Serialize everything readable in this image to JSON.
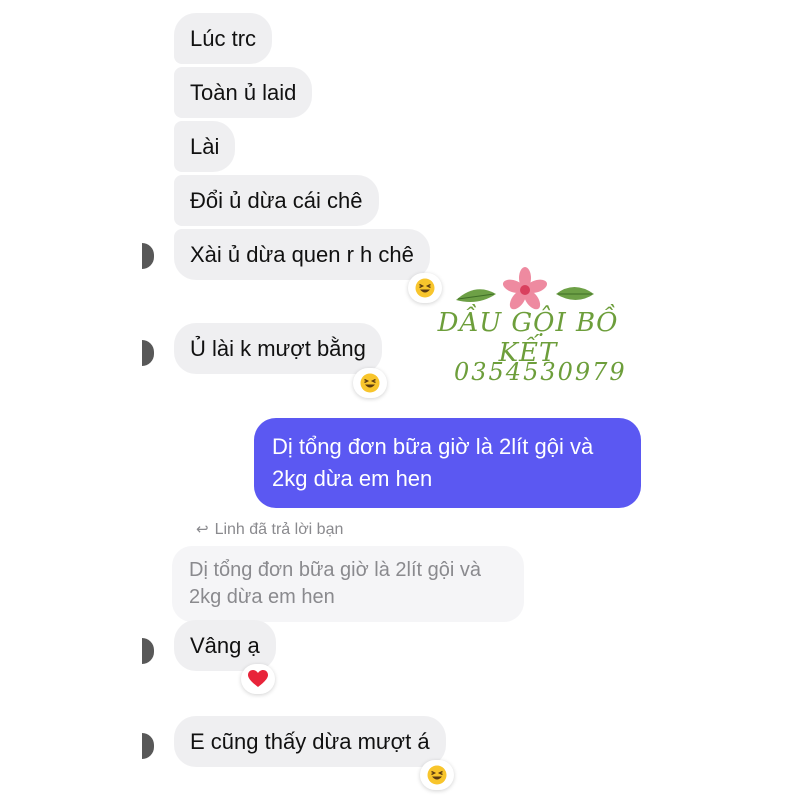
{
  "messages": [
    {
      "text": "Lúc trc"
    },
    {
      "text": "Toàn ủ laid"
    },
    {
      "text": "Lài"
    },
    {
      "text": "Đổi ủ dừa cái chê"
    },
    {
      "text": "Xài ủ dừa quen r h chê"
    },
    {
      "text": "Ủ lài k mượt bằng"
    },
    {
      "text": "Dị tổng đơn bữa giờ là 2lít gội và 2kg dừa em hen"
    },
    {
      "text": "Vâng ạ"
    },
    {
      "text": "E cũng thấy dừa mượt á"
    }
  ],
  "reply": {
    "label": "Linh đã trả lời bạn",
    "quoted_text": "Dị tổng đơn bữa giờ là 2lít gội và 2kg dừa em hen"
  },
  "reactions": {
    "laugh": "laughing-emoji",
    "heart": "red-heart-emoji"
  },
  "watermark": {
    "title": "DẦU GỘI BỒ KẾT",
    "phone": "0354530979"
  },
  "colors": {
    "received_bubble": "#efeff1",
    "sent_bubble": "#5b58f2",
    "watermark_text": "#6d9e3b",
    "watermark_flower": "#ee8aa0"
  }
}
